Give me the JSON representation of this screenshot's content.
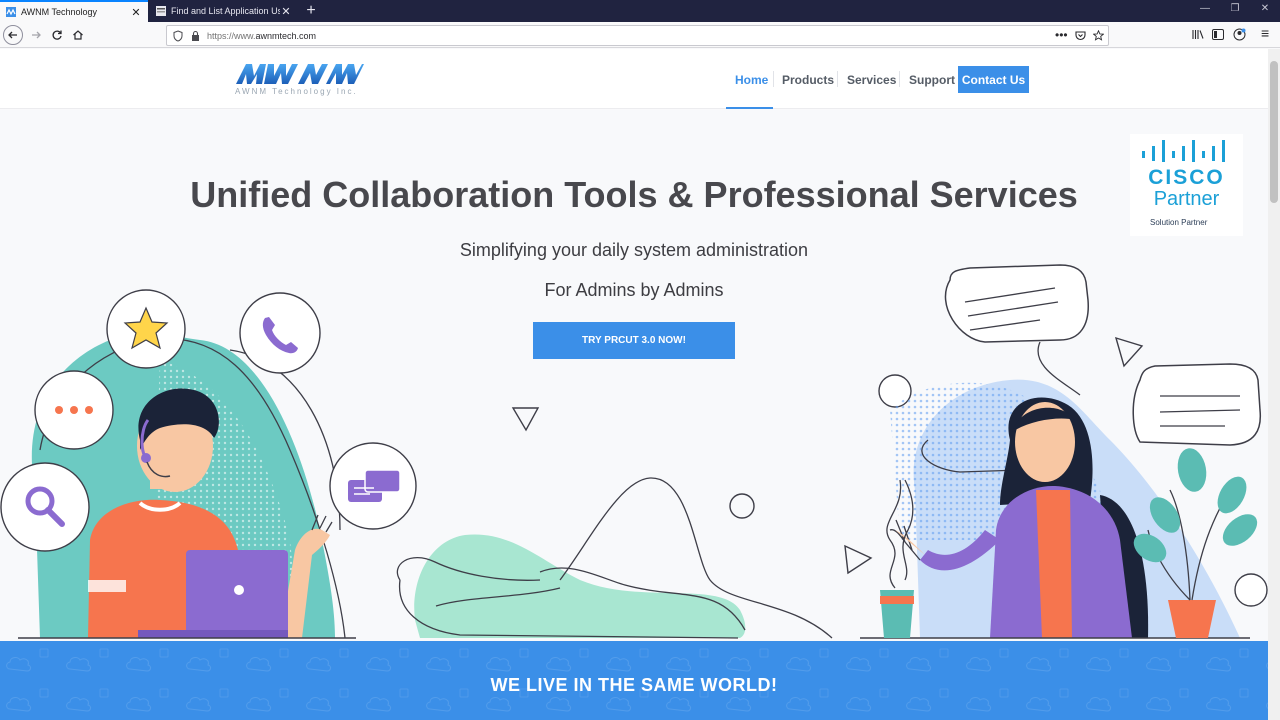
{
  "browser": {
    "tabs": [
      {
        "title": "AWNM Technology",
        "active": true
      },
      {
        "title": "Find and List Application Users",
        "active": false
      }
    ],
    "close_glyph": "✕",
    "new_tab_glyph": "+",
    "url_proto": "https://www.",
    "url_domain": "awnmtech.com",
    "window_controls": [
      "—",
      "❐",
      "✕"
    ],
    "menu_glyph": "≡"
  },
  "site": {
    "logo_text": "AWNM",
    "logo_tagline": "AWNM Technology Inc.",
    "nav": [
      {
        "label": "Home",
        "active": true
      },
      {
        "label": "Products"
      },
      {
        "label": "Services"
      },
      {
        "label": "Support"
      }
    ],
    "contact_label": "Contact Us",
    "colors": {
      "accent": "#3b8fe8",
      "teal": "#6ccac2",
      "purple": "#8b6bd0",
      "orange": "#f6754e",
      "cisco": "#1ba0d7"
    }
  },
  "hero": {
    "title": "Unified Collaboration Tools & Professional Services",
    "subtitle1": "Simplifying your daily system administration",
    "subtitle2": "For Admins by Admins",
    "cta_label": "TRY PRCUT 3.0 NOW!"
  },
  "cisco": {
    "brand": "CISCO",
    "partner": "Partner",
    "level": "Solution Partner"
  },
  "banner": {
    "text": "WE LIVE IN THE SAME WORLD!"
  }
}
